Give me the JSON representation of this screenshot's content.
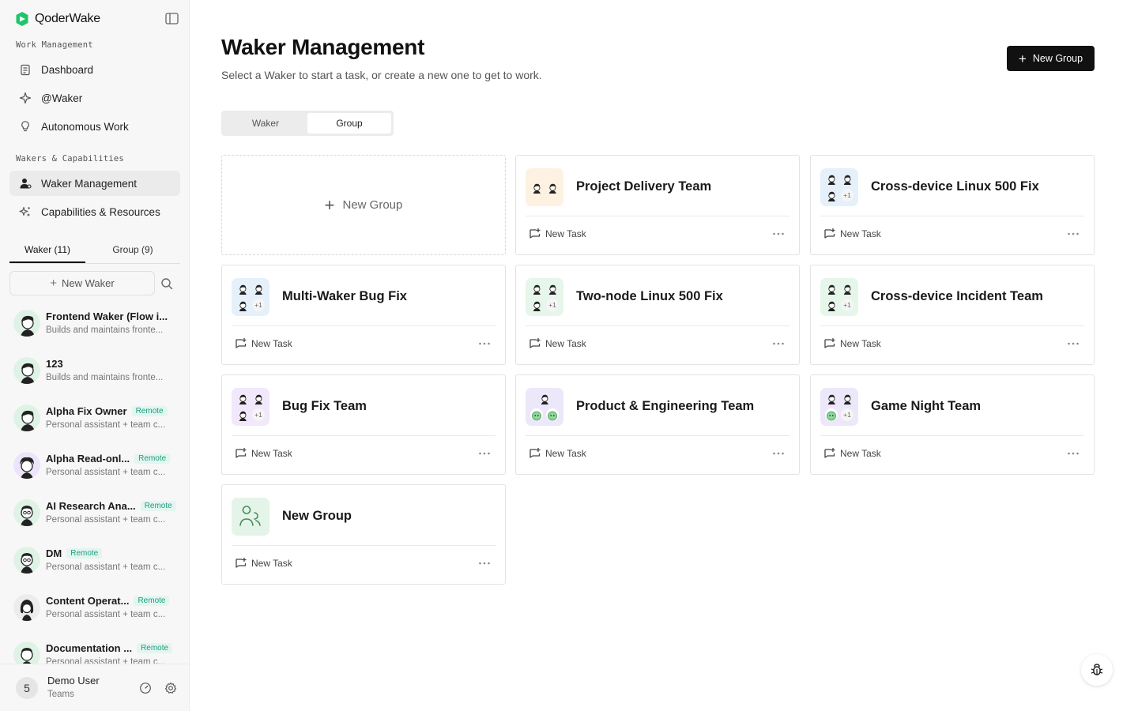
{
  "app": {
    "name": "QoderWake"
  },
  "sidebar": {
    "section_work": "Work Management",
    "nav_work": [
      {
        "label": "Dashboard",
        "icon": "clipboard-icon"
      },
      {
        "label": "@Waker",
        "icon": "sparkle-icon"
      },
      {
        "label": "Autonomous Work",
        "icon": "bulb-icon"
      }
    ],
    "section_wakers": "Wakers & Capabilities",
    "nav_wakers": [
      {
        "label": "Waker Management",
        "icon": "person-icon",
        "active": true
      },
      {
        "label": "Capabilities & Resources",
        "icon": "sparkles-icon"
      }
    ],
    "tabs": [
      {
        "label": "Waker (11)",
        "active": true
      },
      {
        "label": "Group (9)"
      }
    ],
    "new_waker_label": "New Waker",
    "wakers": [
      {
        "name": "Frontend Waker (Flow i...",
        "desc": "Builds and maintains fronte...",
        "badge": ""
      },
      {
        "name": "123",
        "desc": "Builds and maintains fronte...",
        "badge": ""
      },
      {
        "name": "Alpha Fix Owner",
        "desc": "Personal assistant + team c...",
        "badge": "Remote"
      },
      {
        "name": "Alpha Read-onl...",
        "desc": "Personal assistant + team c...",
        "badge": "Remote"
      },
      {
        "name": "AI Research Ana...",
        "desc": "Personal assistant + team c...",
        "badge": "Remote"
      },
      {
        "name": "DM",
        "desc": "Personal assistant + team c...",
        "badge": "Remote"
      },
      {
        "name": "Content Operat...",
        "desc": "Personal assistant + team c...",
        "badge": "Remote"
      },
      {
        "name": "Documentation ...",
        "desc": "Personal assistant + team c...",
        "badge": "Remote"
      }
    ],
    "user": {
      "initial": "5",
      "name": "Demo User",
      "team": "Teams"
    }
  },
  "main": {
    "title": "Waker Management",
    "subtitle": "Select a Waker to start a task, or create a new one to get to work.",
    "new_group_button": "New Group",
    "segments": [
      {
        "label": "Waker"
      },
      {
        "label": "Group",
        "active": true
      }
    ],
    "new_group_card": "New Group",
    "new_task_label": "New Task",
    "groups": [
      {
        "name": "Project Delivery Team",
        "tint": "#fdf1e1"
      },
      {
        "name": "Cross-device Linux 500 Fix",
        "tint": "#e5f0fb"
      },
      {
        "name": "Multi-Waker Bug Fix",
        "tint": "#e5f0fb"
      },
      {
        "name": "Two-node Linux 500 Fix",
        "tint": "#e6f6ea"
      },
      {
        "name": "Cross-device Incident Team",
        "tint": "#e6f6ea"
      },
      {
        "name": "Bug Fix Team",
        "tint": "#f1e8fb"
      },
      {
        "name": "Product & Engineering Team",
        "tint": "#ece8f9"
      },
      {
        "name": "Game Night Team",
        "tint": "#ece8f9"
      },
      {
        "name": "New Group",
        "tint": "#e4f4e8"
      }
    ]
  },
  "colors": {
    "brand": "#1fc46b",
    "remote_badge": "#1e9e80",
    "primary_button": "#111111"
  }
}
